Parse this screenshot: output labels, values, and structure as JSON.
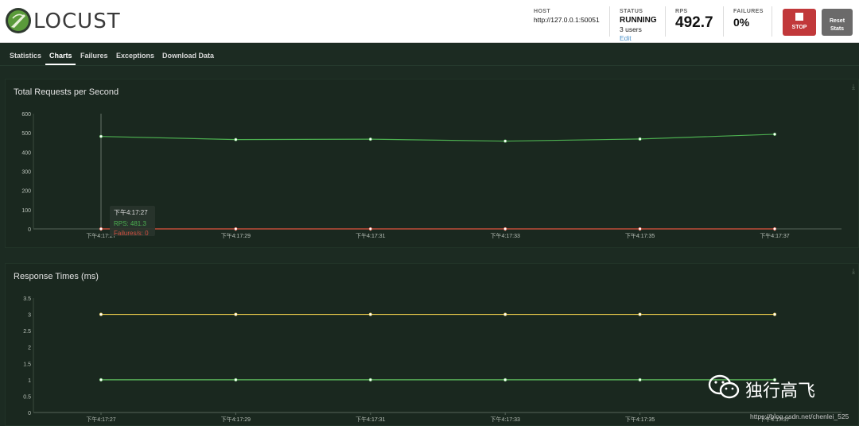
{
  "app": {
    "name": "LOCUST"
  },
  "header": {
    "host_label": "HOST",
    "host_value": "http://127.0.0.1:50051",
    "status_label": "STATUS",
    "status_value": "RUNNING",
    "users": "3 users",
    "edit": "Edit",
    "rps_label": "RPS",
    "rps_value": "492.7",
    "failures_label": "FAILURES",
    "failures_value": "0%",
    "stop_label": "STOP",
    "reset_label_1": "Reset",
    "reset_label_2": "Stats"
  },
  "nav": {
    "tabs": [
      {
        "label": "Statistics"
      },
      {
        "label": "Charts"
      },
      {
        "label": "Failures"
      },
      {
        "label": "Exceptions"
      },
      {
        "label": "Download Data"
      }
    ],
    "active": "Charts"
  },
  "colors": {
    "rps": "#4caf50",
    "failures": "#e0533f",
    "p95": "#e8c84a",
    "median": "#5fbf5f"
  },
  "icons": {
    "download": "download-icon",
    "stop": "stop-square-icon",
    "logo": "locust-logo-icon",
    "wechat": "wechat-icon"
  },
  "chart_data": [
    {
      "type": "line",
      "title": "Total Requests per Second",
      "categories": [
        "下午4:17:27",
        "下午4:17:29",
        "下午4:17:31",
        "下午4:17:33",
        "下午4:17:35",
        "下午4:17:37"
      ],
      "yticks": [
        "0",
        "100",
        "200",
        "300",
        "400",
        "500",
        "600"
      ],
      "ylim": [
        0,
        600
      ],
      "series": [
        {
          "name": "RPS",
          "values": [
            481.3,
            465,
            467,
            457,
            468,
            492.7
          ]
        },
        {
          "name": "Failures/s",
          "values": [
            0,
            0,
            0,
            0,
            0,
            0
          ]
        }
      ],
      "tooltip": {
        "time": "下午4:17:27",
        "rps": "RPS: 481.3",
        "failures": "Failures/s: 0"
      }
    },
    {
      "type": "line",
      "title": "Response Times (ms)",
      "categories": [
        "下午4:17:27",
        "下午4:17:29",
        "下午4:17:31",
        "下午4:17:33",
        "下午4:17:35",
        "下午4:17:37"
      ],
      "yticks": [
        "0",
        "0.5",
        "1",
        "1.5",
        "2",
        "2.5",
        "3",
        "3.5"
      ],
      "ylim": [
        0,
        3.5
      ],
      "series": [
        {
          "values": [
            3,
            3,
            3,
            3,
            3,
            3
          ]
        },
        {
          "values": [
            1,
            1,
            1,
            1,
            1,
            1
          ]
        }
      ]
    }
  ],
  "watermark": {
    "text": "独行高飞",
    "url": "https://blog.csdn.net/chenlei_525"
  }
}
